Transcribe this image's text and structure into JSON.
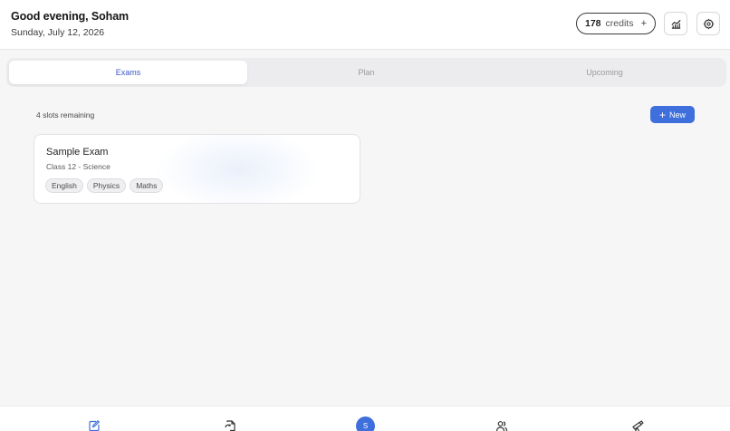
{
  "header": {
    "greeting": "Good evening, Soham",
    "date": "Sunday, July 12, 2026",
    "credits_count": "178",
    "credits_label": "credits",
    "credits_add": "+",
    "analytics_icon": "chart-trend-icon",
    "settings_icon": "gear-icon"
  },
  "tabs": [
    {
      "label": "Exams",
      "active": true
    },
    {
      "label": "Plan",
      "active": false
    },
    {
      "label": "Upcoming",
      "active": false
    }
  ],
  "exams": {
    "slots_text": "4 slots remaining",
    "new_button": "New",
    "new_icon": "plus-icon",
    "cards": [
      {
        "title": "Sample Exam",
        "subtitle": "Class 12 - Science",
        "tags": [
          "English",
          "Physics",
          "Maths"
        ]
      }
    ]
  },
  "bottom_nav": {
    "items": [
      {
        "icon": "edit-icon"
      },
      {
        "icon": "file-refresh-icon"
      },
      {
        "icon": "avatar",
        "label": "S"
      },
      {
        "icon": "users-icon"
      },
      {
        "icon": "telescope-icon"
      }
    ]
  },
  "colors": {
    "accent": "#3e6fdc",
    "active_tab_text": "#3b57c7",
    "background": "#f6f6f7"
  }
}
